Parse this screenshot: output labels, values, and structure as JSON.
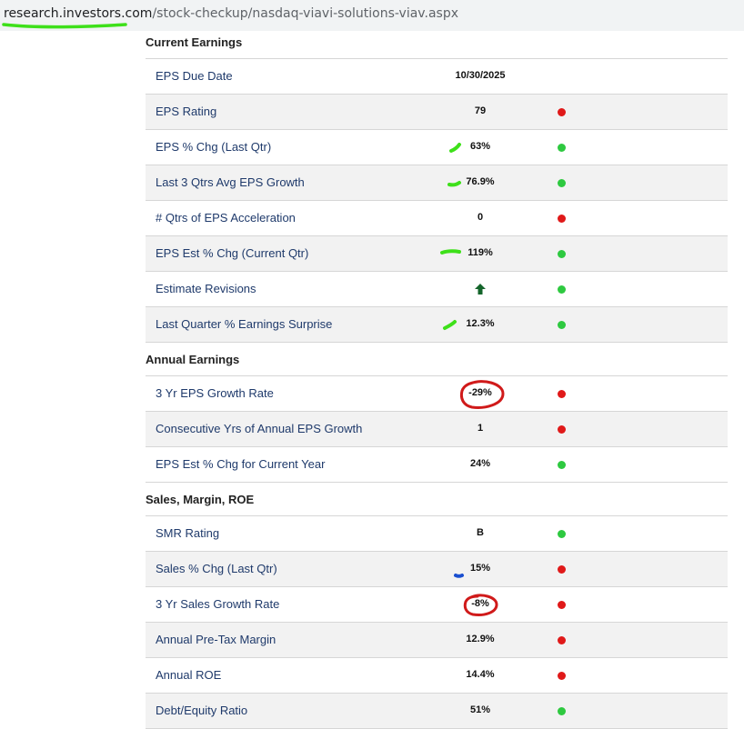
{
  "url": {
    "domain": "research.investors.com",
    "path": "/stock-checkup/nasdaq-viavi-solutions-viav.aspx"
  },
  "sections": {
    "current": {
      "title": "Current Earnings"
    },
    "annual": {
      "title": "Annual Earnings"
    },
    "sales": {
      "title": "Sales, Margin, ROE"
    }
  },
  "rows": [
    {
      "label": "EPS Due Date",
      "value": "10/30/2025",
      "status": "none"
    },
    {
      "label": "EPS Rating",
      "value": "79",
      "status": "red"
    },
    {
      "label": "EPS % Chg (Last Qtr)",
      "value": "63%",
      "status": "green"
    },
    {
      "label": "Last 3 Qtrs Avg EPS Growth",
      "value": "76.9%",
      "status": "green"
    },
    {
      "label": "# Qtrs of EPS Acceleration",
      "value": "0",
      "status": "red"
    },
    {
      "label": "EPS Est % Chg (Current Qtr)",
      "value": "119%",
      "status": "green"
    },
    {
      "label": "Estimate Revisions",
      "value": "",
      "icon": "up-arrow-icon",
      "status": "green"
    },
    {
      "label": "Last Quarter % Earnings Surprise",
      "value": "12.3%",
      "status": "green"
    },
    {
      "label": "3 Yr EPS Growth Rate",
      "value": "-29%",
      "status": "red"
    },
    {
      "label": "Consecutive Yrs of Annual EPS Growth",
      "value": "1",
      "status": "red"
    },
    {
      "label": "EPS Est % Chg for Current Year",
      "value": "24%",
      "status": "green"
    },
    {
      "label": "SMR Rating",
      "value": "B",
      "status": "green"
    },
    {
      "label": "Sales % Chg (Last Qtr)",
      "value": "15%",
      "status": "red"
    },
    {
      "label": "3 Yr Sales Growth Rate",
      "value": "-8%",
      "status": "red"
    },
    {
      "label": "Annual Pre-Tax Margin",
      "value": "12.9%",
      "status": "red"
    },
    {
      "label": "Annual ROE",
      "value": "14.4%",
      "status": "red"
    },
    {
      "label": "Debt/Equity Ratio",
      "value": "51%",
      "status": "green"
    }
  ],
  "colors": {
    "status_green": "#2ec940",
    "status_red": "#e01919",
    "label_blue": "#1f3a6b",
    "highlight_green": "#3ee01a",
    "circle_red": "#d01a1a",
    "mark_blue": "#1a4fd0"
  }
}
